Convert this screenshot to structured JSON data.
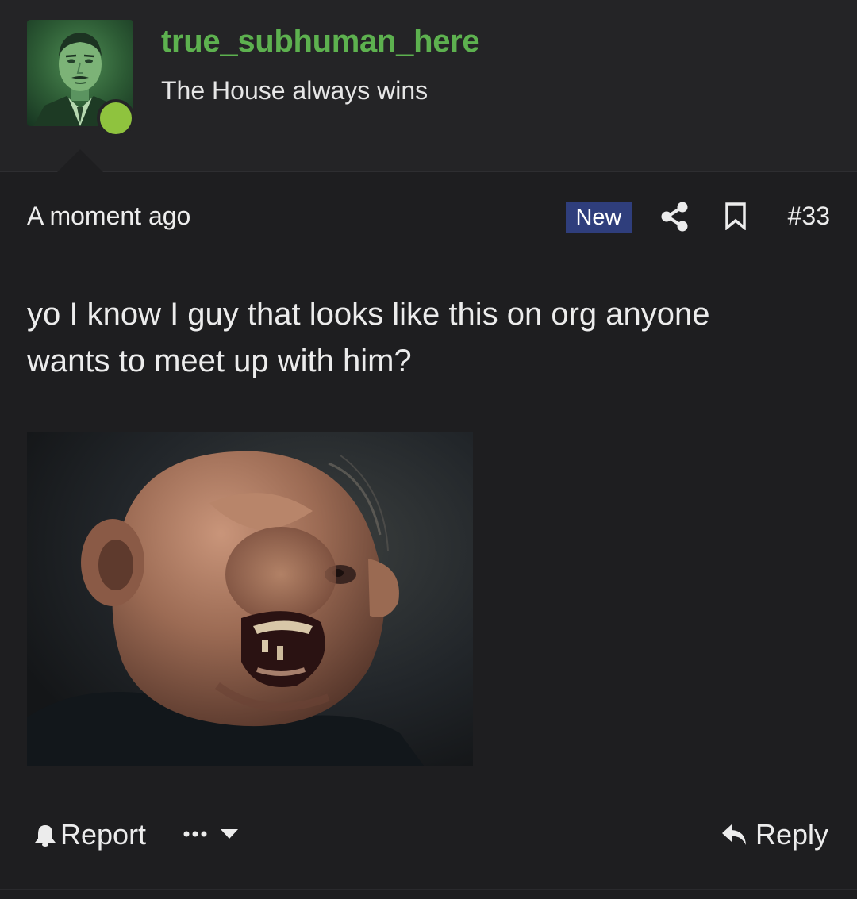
{
  "user": {
    "name": "true_subhuman_here",
    "title": "The House always wins",
    "avatar": "mr-house-portrait-avatar",
    "online": true,
    "online_color": "#8fc33e",
    "name_color": "#5db14f"
  },
  "post": {
    "timestamp": "A moment ago",
    "badge": "New",
    "badge_color": "#2f3e7c",
    "number": "#33",
    "message_line1": "yo I know I guy that looks like this on org anyone",
    "message_line2": "wants to meet up with him?",
    "image": "attached-photo-goonies-sloth-laughing"
  },
  "icons": {
    "share": "share-icon",
    "bookmark": "bookmark-icon",
    "report": "bell-icon",
    "more": "ellipsis-icon",
    "dropdown": "caret-down-icon",
    "reply": "reply-arrow-icon"
  },
  "actions": {
    "report_label": "Report",
    "reply_label": "Reply"
  }
}
